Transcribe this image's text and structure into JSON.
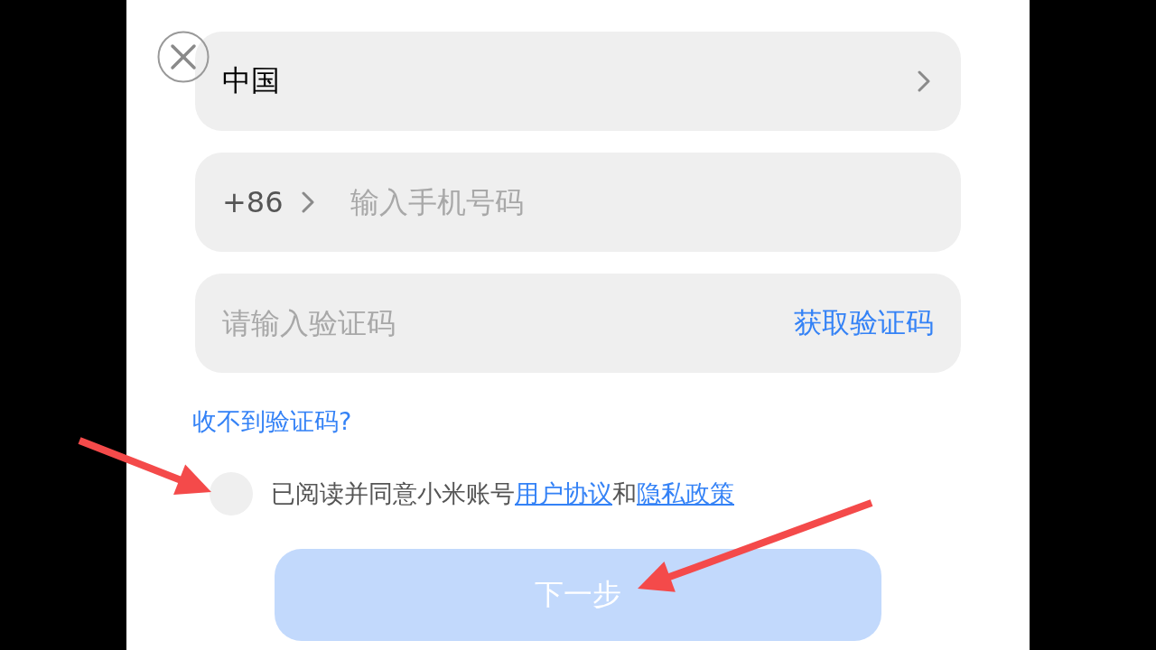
{
  "form": {
    "region_field": {
      "value": "中国"
    },
    "phone_field": {
      "country_code": "+86",
      "placeholder": "输入手机号码"
    },
    "code_field": {
      "placeholder": "请输入验证码",
      "action": "获取验证码"
    }
  },
  "help_link": "收不到验证码?",
  "agreement": {
    "checked": false,
    "parts": [
      {
        "kind": "text",
        "text": "已阅读并同意小米账号"
      },
      {
        "kind": "link",
        "text": "用户协议"
      },
      {
        "kind": "text",
        "text": "和"
      },
      {
        "kind": "link",
        "text": "隐私政策"
      }
    ]
  },
  "next_button": {
    "label": "下一步",
    "disabled": true
  },
  "annotations": [
    {
      "kind": "arrow"
    },
    {
      "kind": "arrow"
    }
  ]
}
